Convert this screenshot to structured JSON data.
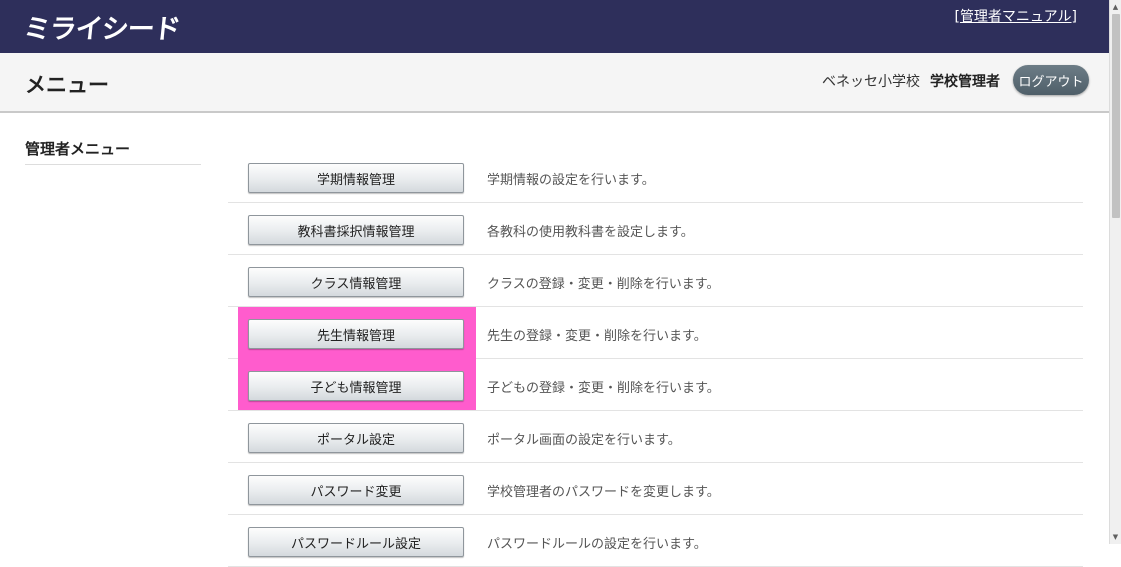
{
  "header": {
    "logo_text": "ミライシード",
    "manual_link": {
      "bracket_open": "[",
      "label": "管理者マニュアル",
      "bracket_close": "]"
    }
  },
  "subheader": {
    "title": "メニュー",
    "school_name": "ベネッセ小学校",
    "user_role": "学校管理者",
    "logout_label": "ログアウト"
  },
  "sidebar": {
    "heading": "管理者メニュー"
  },
  "menu": {
    "items": [
      {
        "button": "学期情報管理",
        "description": "学期情報の設定を行います。"
      },
      {
        "button": "教科書採択情報管理",
        "description": "各教科の使用教科書を設定します。"
      },
      {
        "button": "クラス情報管理",
        "description": "クラスの登録・変更・削除を行います。"
      },
      {
        "button": "先生情報管理",
        "description": "先生の登録・変更・削除を行います。"
      },
      {
        "button": "子ども情報管理",
        "description": "子どもの登録・変更・削除を行います。"
      },
      {
        "button": "ポータル設定",
        "description": "ポータル画面の設定を行います。"
      },
      {
        "button": "パスワード変更",
        "description": "学校管理者のパスワードを変更します。"
      },
      {
        "button": "パスワードルール設定",
        "description": "パスワードルールの設定を行います。"
      }
    ]
  },
  "colors": {
    "header_bg": "#2e2f5b",
    "highlight": "#ff5ccd",
    "logout_bg": "#5a6a74"
  }
}
